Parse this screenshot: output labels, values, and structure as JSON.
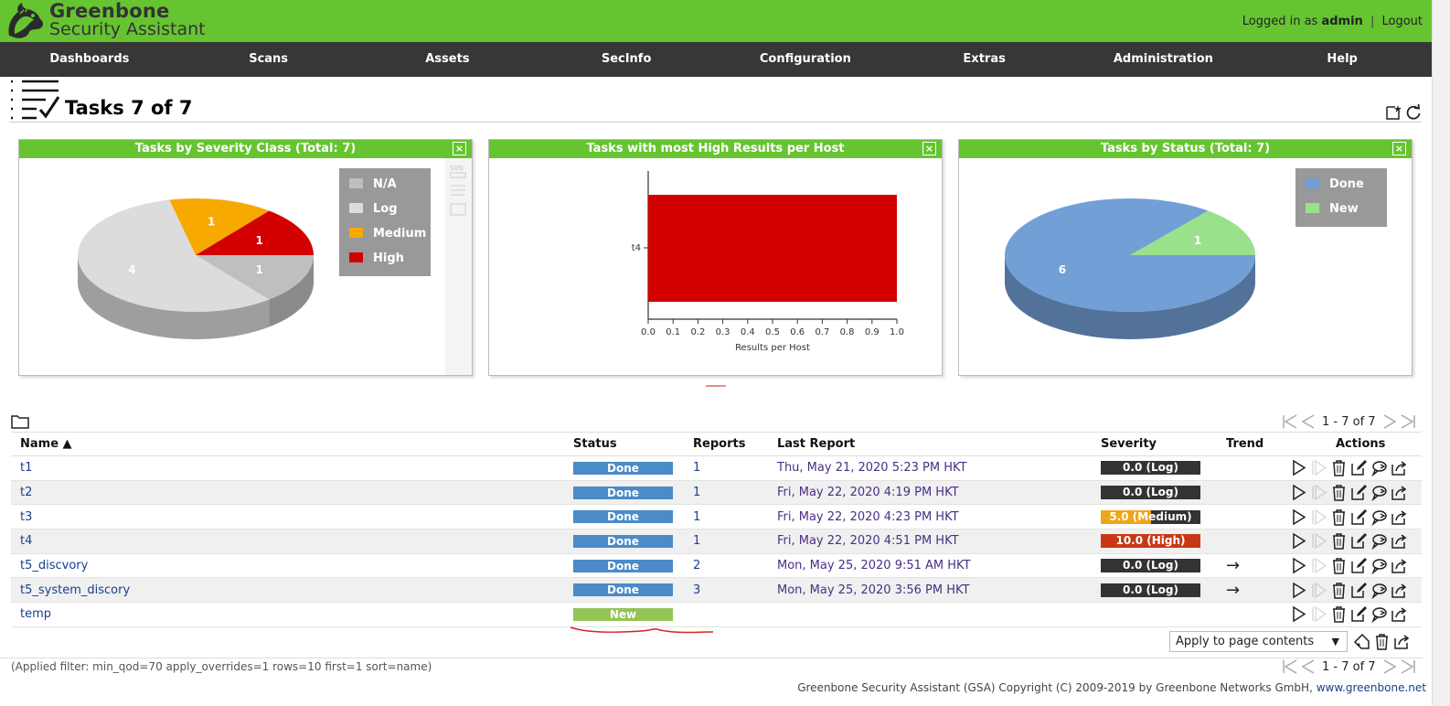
{
  "brand": {
    "line1": "Greenbone",
    "line2": "Security Assistant"
  },
  "login": {
    "prefix": "Logged in as",
    "user": "admin",
    "separator": "|",
    "logout": "Logout"
  },
  "nav": [
    "Dashboards",
    "Scans",
    "Assets",
    "SecInfo",
    "Configuration",
    "Extras",
    "Administration",
    "Help"
  ],
  "page": {
    "title": "Tasks 7 of 7"
  },
  "panels": {
    "severity": {
      "title": "Tasks by Severity Class (Total: 7)",
      "close": "×"
    },
    "hosts": {
      "title": "Tasks with most High Results per Host",
      "close": "×"
    },
    "status": {
      "title": "Tasks by Status (Total: 7)",
      "close": "×"
    }
  },
  "chart_data": [
    {
      "type": "pie",
      "title": "Tasks by Severity Class (Total: 7)",
      "categories": [
        "N/A",
        "Log",
        "Medium",
        "High"
      ],
      "values": [
        1,
        4,
        1,
        1
      ],
      "colors": [
        "#bfbfbf",
        "#dcdcdc",
        "#f8a900",
        "#d20000"
      ],
      "legend_position": "top-right",
      "labels": [
        "1",
        "4",
        "1",
        "1"
      ]
    },
    {
      "type": "bar",
      "title": "Tasks with most High Results per Host",
      "orientation": "horizontal",
      "categories": [
        "t4"
      ],
      "values": [
        1.0
      ],
      "xlabel": "Results per Host",
      "xlim": [
        0.0,
        1.0
      ],
      "xticks": [
        "0.0",
        "0.1",
        "0.2",
        "0.3",
        "0.4",
        "0.5",
        "0.6",
        "0.7",
        "0.8",
        "0.9",
        "1.0"
      ],
      "color": "#d20000"
    },
    {
      "type": "pie",
      "title": "Tasks by Status (Total: 7)",
      "categories": [
        "Done",
        "New"
      ],
      "values": [
        6,
        1
      ],
      "colors": [
        "#729fd6",
        "#99e28b"
      ],
      "legend_position": "top-right",
      "labels": [
        "6",
        "1"
      ]
    }
  ],
  "pager": {
    "count": "1 - 7 of 7"
  },
  "table": {
    "headers": {
      "name": "Name ▲",
      "status": "Status",
      "reports": "Reports",
      "last_report": "Last Report",
      "severity": "Severity",
      "trend": "Trend",
      "actions": "Actions"
    },
    "rows": [
      {
        "name": "t1",
        "status": "Done",
        "reports": "1",
        "last_report": "Thu, May 21, 2020 5:23 PM HKT",
        "severity": "0.0 (Log)",
        "sev_value": 0.0,
        "sev_color": "#333333",
        "trend": ""
      },
      {
        "name": "t2",
        "status": "Done",
        "reports": "1",
        "last_report": "Fri, May 22, 2020 4:19 PM HKT",
        "severity": "0.0 (Log)",
        "sev_value": 0.0,
        "sev_color": "#333333",
        "trend": ""
      },
      {
        "name": "t3",
        "status": "Done",
        "reports": "1",
        "last_report": "Fri, May 22, 2020 4:23 PM HKT",
        "severity": "5.0 (Medium)",
        "sev_value": 5.0,
        "sev_color": "#f0a519",
        "trend": ""
      },
      {
        "name": "t4",
        "status": "Done",
        "reports": "1",
        "last_report": "Fri, May 22, 2020 4:51 PM HKT",
        "severity": "10.0 (High)",
        "sev_value": 10.0,
        "sev_color": "#c83814",
        "trend": ""
      },
      {
        "name": "t5_discvory",
        "status": "Done",
        "reports": "2",
        "last_report": "Mon, May 25, 2020 9:51 AM HKT",
        "severity": "0.0 (Log)",
        "sev_value": 0.0,
        "sev_color": "#333333",
        "trend": "→"
      },
      {
        "name": "t5_system_discory",
        "status": "Done",
        "reports": "3",
        "last_report": "Mon, May 25, 2020 3:56 PM HKT",
        "severity": "0.0 (Log)",
        "sev_value": 0.0,
        "sev_color": "#333333",
        "trend": "→"
      },
      {
        "name": "temp",
        "status": "New",
        "reports": "",
        "last_report": "",
        "severity": "",
        "sev_value": null,
        "sev_color": "",
        "trend": ""
      }
    ]
  },
  "bulk": {
    "apply_label": "Apply to page contents",
    "arrow": "▼"
  },
  "filter": "(Applied filter: min_qod=70 apply_overrides=1 rows=10 first=1 sort=name)",
  "footer": {
    "text": "Greenbone Security Assistant (GSA) Copyright (C) 2009-2019 by Greenbone Networks GmbH,",
    "link": "www.greenbone.net"
  },
  "icons": {
    "logo": "greenbone-dragon-icon",
    "tasks": "task-list-icon",
    "new_task": "new-task-icon",
    "refresh": "refresh-icon",
    "folder": "folder-icon",
    "first": "first-page-icon",
    "prev": "previous-page-icon",
    "next": "next-page-icon",
    "last": "last-page-icon",
    "start": "start-icon",
    "resume": "resume-icon",
    "delete": "trash-icon",
    "edit": "edit-icon",
    "clone": "clone-icon",
    "export": "export-icon",
    "tag": "tag-icon"
  },
  "colors": {
    "brand_green": "#66c430",
    "nav_dark": "#393637",
    "link": "#1a3e8c"
  }
}
